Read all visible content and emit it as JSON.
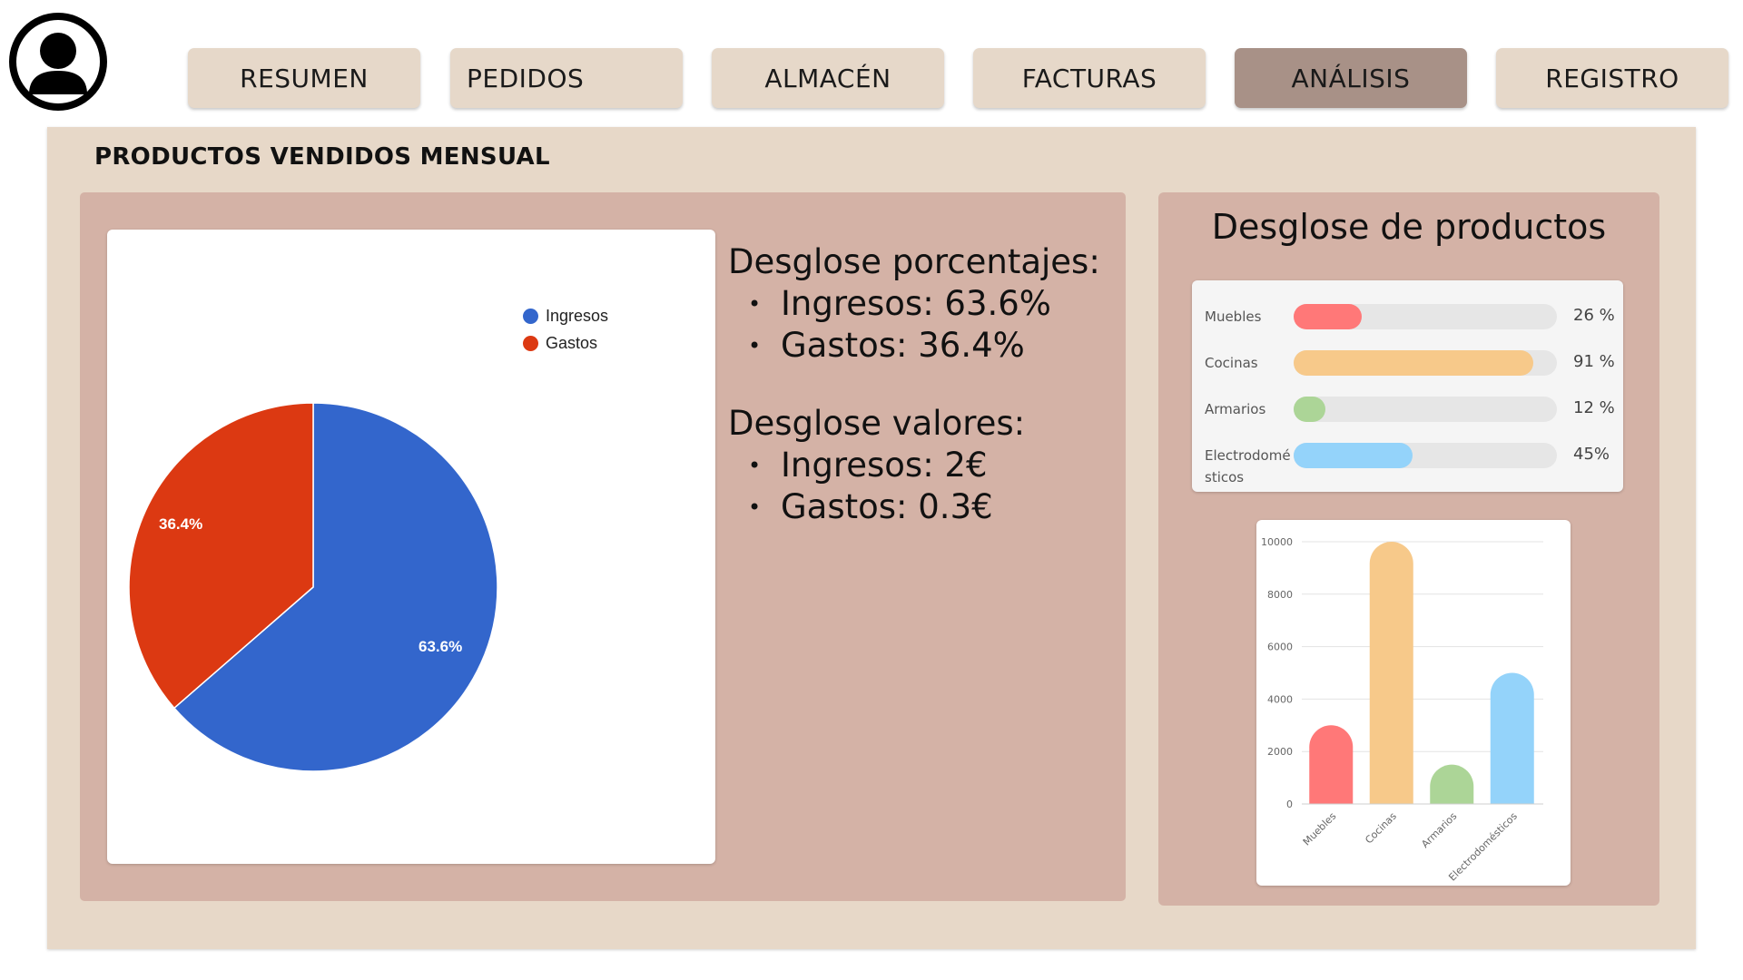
{
  "nav": {
    "tabs": [
      {
        "label": "RESUMEN",
        "active": false
      },
      {
        "label": "PEDIDOS",
        "active": false
      },
      {
        "label": "ALMACÉN",
        "active": false
      },
      {
        "label": "FACTURAS",
        "active": false
      },
      {
        "label": "ANÁLISIS",
        "active": true
      },
      {
        "label": "REGISTRO",
        "active": false
      }
    ]
  },
  "section": {
    "title": "PRODUCTOS VENDIDOS MENSUAL"
  },
  "pie": {
    "legend": [
      "Ingresos",
      "Gastos"
    ],
    "labels": [
      "63.6%",
      "36.4%"
    ]
  },
  "breakdown": {
    "percent_title": "Desglose porcentajes:",
    "percent_items": [
      "Ingresos: 63.6%",
      "Gastos: 36.4%"
    ],
    "values_title": "Desglose valores:",
    "values_items": [
      "Ingresos: 2€",
      "Gastos: 0.3€"
    ],
    "bullet": "•"
  },
  "products": {
    "title": "Desglose de productos",
    "rows": [
      {
        "label": "Muebles",
        "value_text": "26 %",
        "percent": 26,
        "color": "#ff7878"
      },
      {
        "label": "Cocinas",
        "value_text": "91 %",
        "percent": 91,
        "color": "#f7c98a"
      },
      {
        "label": "Armarios",
        "value_text": "12 %",
        "percent": 12,
        "color": "#acd597"
      },
      {
        "label": "Electrodomésticos",
        "label_lines": [
          "Electrodomé",
          "sticos"
        ],
        "value_text": "45%",
        "percent": 45,
        "color": "#94d3fa"
      }
    ]
  },
  "colors": {
    "ingresos": "#3366cc",
    "gastos": "#dc3912",
    "active_tab": "#a89187",
    "tab": "#e6d8c9"
  },
  "chart_data": [
    {
      "type": "pie",
      "categories": [
        "Ingresos",
        "Gastos"
      ],
      "values": [
        63.6,
        36.4
      ],
      "colors": [
        "#3366cc",
        "#dc3912"
      ],
      "legend": "right-top"
    },
    {
      "type": "bar",
      "categories": [
        "Muebles",
        "Cocinas",
        "Armarios",
        "Electrodomésticos"
      ],
      "values": [
        3000,
        10000,
        1500,
        5000
      ],
      "colors": [
        "#ff7878",
        "#f7c98a",
        "#acd597",
        "#94d3fa"
      ],
      "yticks": [
        "0",
        "2000",
        "4000",
        "6000",
        "8000",
        "10000"
      ],
      "ylim": [
        0,
        10000
      ],
      "grid": true
    }
  ]
}
